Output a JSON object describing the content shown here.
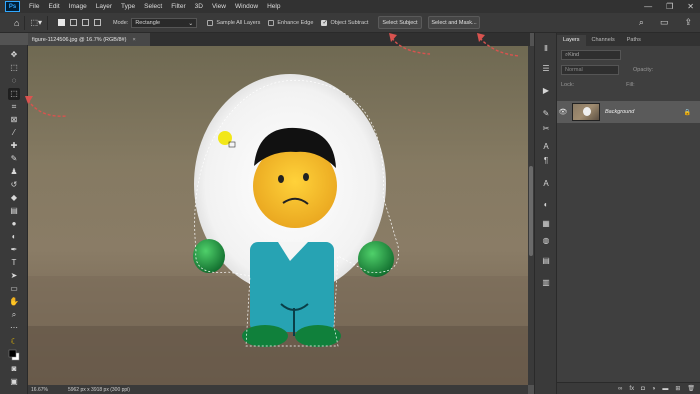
{
  "app": {
    "logo": "Ps",
    "menus": [
      "File",
      "Edit",
      "Image",
      "Layer",
      "Type",
      "Select",
      "Filter",
      "3D",
      "View",
      "Window",
      "Help"
    ],
    "window_controls": [
      "—",
      "❐",
      "✕"
    ]
  },
  "options_bar": {
    "mode_label": "Mode:",
    "mode_value": "Rectangle",
    "sample_all_layers": "Sample All Layers",
    "enhance_edge": "Enhance Edge",
    "object_subtract": "Object Subtract",
    "select_subject": "Select Subject",
    "select_and_mask": "Select and Mask..."
  },
  "document": {
    "tab_title": "figure-1124506.jpg @ 16.7% (RGB/8#)",
    "tab_close": "×",
    "zoom": "16.67%",
    "dimensions": "5962 px x 3918 px (300 ppi)"
  },
  "panels": {
    "tabs": [
      "Layers",
      "Channels",
      "Paths"
    ],
    "active_tab": "Layers",
    "kind_placeholder": "Kind",
    "blend_mode": "Normal",
    "opacity_label": "Opacity:",
    "lock_label": "Lock:",
    "fill_label": "Fill:",
    "layer_name": "Background"
  },
  "colors": {
    "accent": "#d9534f",
    "cursor_yellow": "#f2e600"
  },
  "icons": {
    "toolbar": [
      "move-icon",
      "marquee-icon",
      "lasso-icon",
      "object-selection-icon",
      "crop-icon",
      "frame-icon",
      "eyedropper-icon",
      "healing-brush-icon",
      "brush-icon",
      "clone-stamp-icon",
      "history-brush-icon",
      "eraser-icon",
      "gradient-icon",
      "blur-icon",
      "dodge-icon",
      "pen-icon",
      "type-icon",
      "path-selection-icon",
      "rectangle-icon",
      "hand-icon",
      "zoom-icon",
      "edit-toolbar-icon",
      "color-swatch-icon",
      "quick-mask-icon",
      "screen-mode-icon"
    ]
  }
}
